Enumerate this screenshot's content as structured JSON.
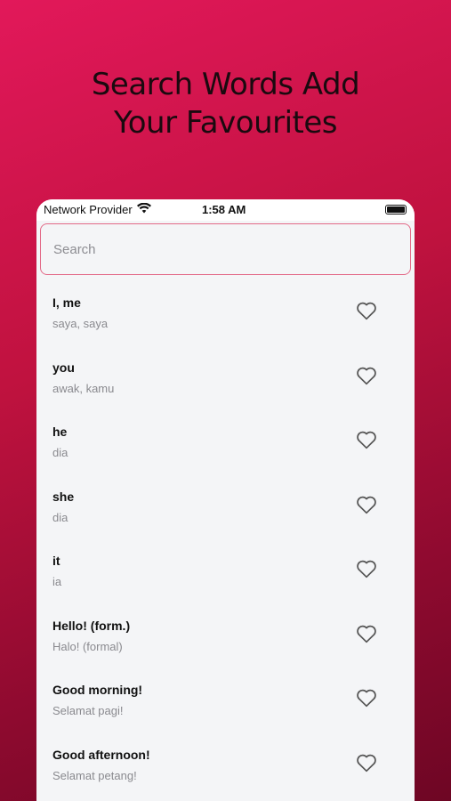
{
  "headline": {
    "line1": "Search Words Add",
    "line2": "Your Favourites"
  },
  "status_bar": {
    "carrier": "Network Provider",
    "time": "1:58 AM",
    "icons": [
      "wifi-icon",
      "battery-icon"
    ]
  },
  "search": {
    "placeholder": "Search",
    "value": ""
  },
  "colors": {
    "background_gradient_start": "#e2185a",
    "background_gradient_end": "#6e0624",
    "search_border": "#e36a88",
    "card_background": "#f4f5f7"
  },
  "words": [
    {
      "word": "I, me",
      "translation": "saya, saya",
      "favourite": false
    },
    {
      "word": "you",
      "translation": "awak, kamu",
      "favourite": false
    },
    {
      "word": "he",
      "translation": "dia",
      "favourite": false
    },
    {
      "word": "she",
      "translation": "dia",
      "favourite": false
    },
    {
      "word": "it",
      "translation": "ia",
      "favourite": false
    },
    {
      "word": "Hello! (form.)",
      "translation": "Halo! (formal)",
      "favourite": false
    },
    {
      "word": "Good morning!",
      "translation": "Selamat pagi!",
      "favourite": false
    },
    {
      "word": "Good afternoon!",
      "translation": "Selamat petang!",
      "favourite": false
    }
  ]
}
